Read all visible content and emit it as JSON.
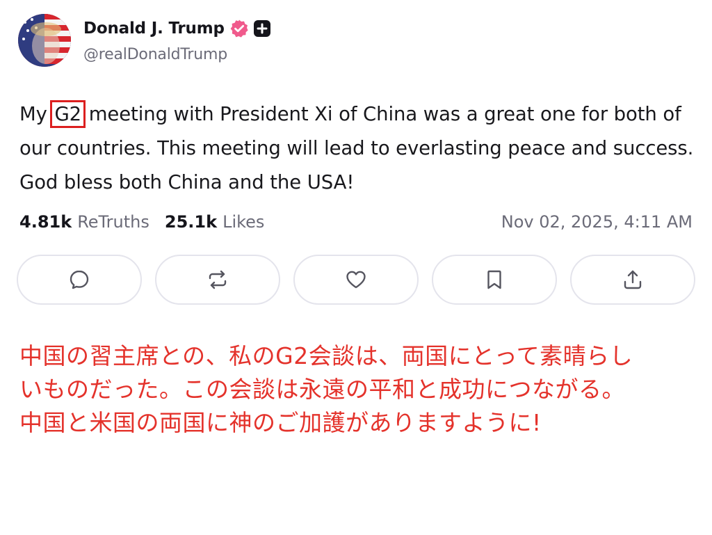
{
  "author": {
    "display_name": "Donald J. Trump",
    "handle": "@realDonaldTrump",
    "avatar_icon": "avatar-image",
    "verified_icon": "verified-badge-icon",
    "plus_icon": "plus-badge-icon"
  },
  "post": {
    "text_before": "My ",
    "highlighted": "G2",
    "text_after": " meeting with President Xi of China was a great one for both of our countries. This meeting will lead to everlasting peace and success. God bless both China and the USA!"
  },
  "stats": {
    "retruths_count": "4.81k",
    "retruths_label": "ReTruths",
    "likes_count": "25.1k",
    "likes_label": "Likes",
    "timestamp": "Nov 02, 2025, 4:11 AM"
  },
  "actions": [
    {
      "name": "reply",
      "icon": "comment-icon"
    },
    {
      "name": "retruth",
      "icon": "repost-icon"
    },
    {
      "name": "like",
      "icon": "heart-icon"
    },
    {
      "name": "bookmark",
      "icon": "bookmark-icon"
    },
    {
      "name": "share",
      "icon": "share-icon"
    }
  ],
  "translation": {
    "lines": [
      "中国の習主席との、私のG2会談は、両国にとって素晴らし",
      "いものだった。この会談は永遠の平和と成功につながる。",
      "中国と米国の両国に神のご加護がありますように!"
    ]
  },
  "colors": {
    "highlight": "#dc1f1f",
    "translation": "#e4322b",
    "verified_badge": "#f05a8c",
    "muted_text": "#6b6b78"
  }
}
